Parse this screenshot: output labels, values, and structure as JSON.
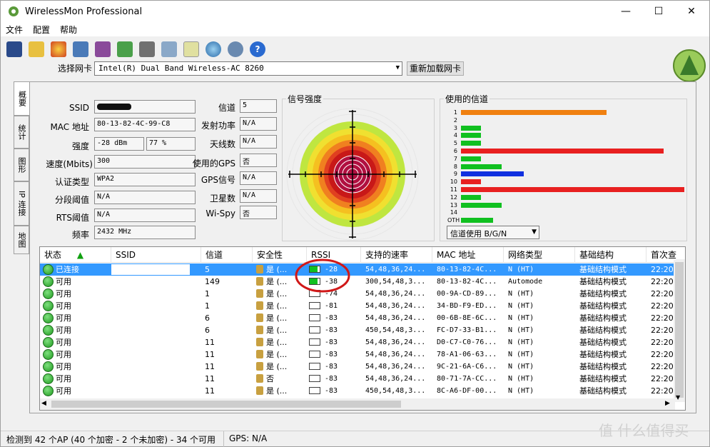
{
  "window": {
    "title": "WirelessMon Professional",
    "minimize": "—",
    "maximize": "☐",
    "close": "✕"
  },
  "menu": [
    "文件",
    "配置",
    "帮助"
  ],
  "nic": {
    "label": "选择网卡",
    "value": "Intel(R) Dual Band Wireless-AC 8260",
    "reload": "重新加载网卡"
  },
  "tabs": [
    "概要",
    "统计",
    "图形",
    "IP 连接",
    "地图"
  ],
  "fields": {
    "ssid_label": "SSID",
    "ssid_value": "",
    "mac_label": "MAC 地址",
    "mac_value": "80-13-82-4C-99-C8",
    "strength_label": "强度",
    "strength_dbm": "-28 dBm",
    "strength_pct": "77 %",
    "speed_label": "速度(Mbits)",
    "speed_value": "300",
    "auth_label": "认证类型",
    "auth_value": "WPA2",
    "frag_label": "分段阈值",
    "frag_value": "N/A",
    "rts_label": "RTS阈值",
    "rts_value": "N/A",
    "freq_label": "频率",
    "freq_value": "2432 MHz",
    "channel_label": "信道",
    "channel_value": "5",
    "txpower_label": "发射功率",
    "txpower_value": "N/A",
    "antenna_label": "天线数",
    "antenna_value": "N/A",
    "usegps_label": "使用的GPS",
    "usegps_value": "否",
    "gpssig_label": "GPS信号",
    "gpssig_value": "N/A",
    "sat_label": "卫星数",
    "sat_value": "N/A",
    "wispy_label": "Wi-Spy",
    "wispy_value": "否"
  },
  "signal": {
    "title": "信号强度"
  },
  "channels": {
    "title": "使用的信道",
    "labels": [
      "1",
      "2",
      "3",
      "4",
      "5",
      "6",
      "7",
      "8",
      "9",
      "10",
      "11",
      "12",
      "13",
      "14",
      "OTH"
    ],
    "usage": [
      0.72,
      0,
      0.1,
      0.1,
      0.1,
      1.0,
      0.1,
      0.2,
      0.31,
      0.1,
      1.12,
      0.1,
      0.2,
      0,
      0.16
    ],
    "colors": [
      "#f08010",
      "#10c020",
      "#10c020",
      "#10c020",
      "#10c020",
      "#e82020",
      "#10c020",
      "#10c020",
      "#1030e0",
      "#e82020",
      "#e82020",
      "#10c020",
      "#10c020",
      "#10c020",
      "#10c020"
    ],
    "select": "信道使用 B/G/N"
  },
  "table": {
    "headers": [
      "状态",
      "SSID",
      "信道",
      "安全性",
      "RSSI",
      "支持的速率",
      "MAC 地址",
      "网络类型",
      "基础结构",
      "首次查"
    ],
    "rows": [
      {
        "status": "已连接",
        "ssid": "",
        "channel": "5",
        "sec": "是 (...",
        "rssi": "-28",
        "rates": "54,48,36,24...",
        "mac": "80-13-82-4C...",
        "net": "N (HT)",
        "infra": "基础结构模式",
        "time": "22:20:"
      },
      {
        "status": "可用",
        "ssid": "",
        "channel": "149",
        "sec": "是 (...",
        "rssi": "-38",
        "rates": "300,54,48,3...",
        "mac": "80-13-82-4C...",
        "net": "Automode",
        "infra": "基础结构模式",
        "time": "22:20:"
      },
      {
        "status": "可用",
        "ssid": "",
        "channel": "1",
        "sec": "是 (...",
        "rssi": "-74",
        "rates": "54,48,36,24...",
        "mac": "00-9A-CD-89...",
        "net": "N (HT)",
        "infra": "基础结构模式",
        "time": "22:20:"
      },
      {
        "status": "可用",
        "ssid": "",
        "channel": "1",
        "sec": "是 (...",
        "rssi": "-81",
        "rates": "54,48,36,24...",
        "mac": "34-BD-F9-ED...",
        "net": "N (HT)",
        "infra": "基础结构模式",
        "time": "22:20:"
      },
      {
        "status": "可用",
        "ssid": "",
        "channel": "6",
        "sec": "是 (...",
        "rssi": "-83",
        "rates": "54,48,36,24...",
        "mac": "00-6B-8E-6C...",
        "net": "N (HT)",
        "infra": "基础结构模式",
        "time": "22:20:"
      },
      {
        "status": "可用",
        "ssid": "",
        "channel": "6",
        "sec": "是 (...",
        "rssi": "-83",
        "rates": "450,54,48,3...",
        "mac": "FC-D7-33-B1...",
        "net": "N (HT)",
        "infra": "基础结构模式",
        "time": "22:20:"
      },
      {
        "status": "可用",
        "ssid": "",
        "channel": "11",
        "sec": "是 (...",
        "rssi": "-83",
        "rates": "54,48,36,24...",
        "mac": "D0-C7-C0-76...",
        "net": "N (HT)",
        "infra": "基础结构模式",
        "time": "22:20:"
      },
      {
        "status": "可用",
        "ssid": "",
        "channel": "11",
        "sec": "是 (...",
        "rssi": "-83",
        "rates": "54,48,36,24...",
        "mac": "78-A1-06-63...",
        "net": "N (HT)",
        "infra": "基础结构模式",
        "time": "22:20:"
      },
      {
        "status": "可用",
        "ssid": "",
        "channel": "11",
        "sec": "是 (...",
        "rssi": "-83",
        "rates": "54,48,36,24...",
        "mac": "9C-21-6A-C6...",
        "net": "N (HT)",
        "infra": "基础结构模式",
        "time": "22:20:"
      },
      {
        "status": "可用",
        "ssid": "",
        "channel": "11",
        "sec": "否",
        "rssi": "-83",
        "rates": "54,48,36,24...",
        "mac": "80-71-7A-CC...",
        "net": "N (HT)",
        "infra": "基础结构模式",
        "time": "22:20:"
      },
      {
        "status": "可用",
        "ssid": "",
        "channel": "11",
        "sec": "是 (...",
        "rssi": "-83",
        "rates": "450,54,48,3...",
        "mac": "8C-A6-DF-00...",
        "net": "N (HT)",
        "infra": "基础结构模式",
        "time": "22:20:"
      }
    ]
  },
  "status": {
    "summary": "检测到 42 个AP (40 个加密 - 2 个未加密) - 34 个可用",
    "gps": "GPS: N/A"
  },
  "watermark": "值 什么值得买"
}
